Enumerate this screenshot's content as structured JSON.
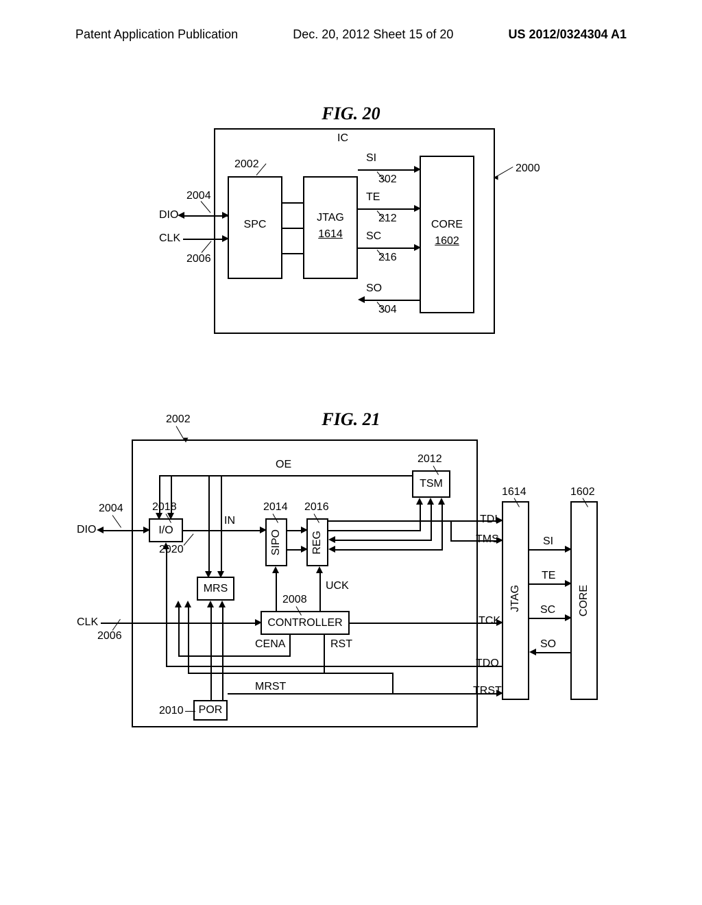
{
  "header": {
    "left": "Patent Application Publication",
    "center": "Dec. 20, 2012  Sheet 15 of 20",
    "right": "US 2012/0324304 A1"
  },
  "fig20": {
    "title": "FIG. 20",
    "ic_label": "IC",
    "spc": {
      "label": "SPC",
      "ref": "2002"
    },
    "jtag": {
      "label": "JTAG",
      "ref": "1614"
    },
    "core": {
      "label": "CORE",
      "ref": "1602"
    },
    "dio": {
      "label": "DIO",
      "ref": "2004"
    },
    "clk": {
      "label": "CLK",
      "ref": "2006"
    },
    "si": {
      "label": "SI",
      "ref": "302"
    },
    "te": {
      "label": "TE",
      "ref": "212"
    },
    "sc": {
      "label": "SC",
      "ref": "216"
    },
    "so": {
      "label": "SO",
      "ref": "304"
    },
    "chip_ref": "2000"
  },
  "fig21": {
    "title": "FIG. 21",
    "outer_ref": "2002",
    "dio": {
      "label": "DIO",
      "ref": "2004"
    },
    "clk": {
      "label": "CLK",
      "ref": "2006"
    },
    "io": {
      "label": "I/O",
      "ref": "2018"
    },
    "in": "IN",
    "in_ref": "2020",
    "sipo": {
      "label": "SIPO",
      "ref": "2014"
    },
    "reg": {
      "label": "REG",
      "ref": "2016"
    },
    "mrs": "MRS",
    "controller": {
      "label": "CONTROLLER",
      "ref": "2008"
    },
    "por": {
      "label": "POR",
      "ref": "2010"
    },
    "tsm": {
      "label": "TSM",
      "ref": "2012"
    },
    "oe": "OE",
    "uck": "UCK",
    "cena": "CENA",
    "rst": "RST",
    "mrst": "MRST",
    "jtag": {
      "label": "JTAG",
      "ref": "1614"
    },
    "core": {
      "label": "CORE",
      "ref": "1602"
    },
    "tdi": "TDI",
    "tms": "TMS",
    "tck": "TCK",
    "tdo": "TDO",
    "trst": "TRST",
    "si": "SI",
    "te": "TE",
    "sc": "SC",
    "so": "SO"
  }
}
